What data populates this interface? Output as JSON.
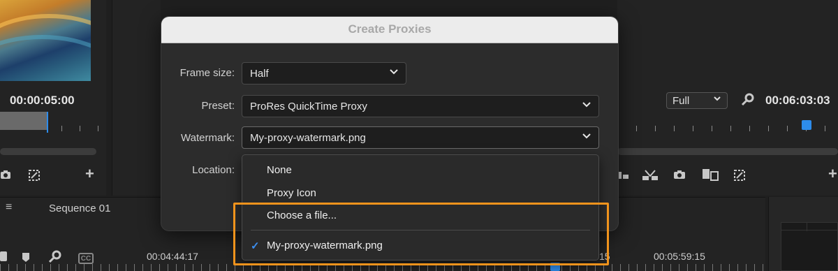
{
  "source_monitor": {
    "timecode": "00:00:05:00"
  },
  "program_monitor": {
    "zoom_label": "Full",
    "timecode": "00:06:03:03"
  },
  "timeline": {
    "menu_glyph": "≡",
    "sequence_tab": "Sequence 01",
    "time_left": "00:04:44:17",
    "time_right": "00:05:59:15",
    "time_partial": "15",
    "cc_label": "CC"
  },
  "dialog": {
    "title": "Create Proxies",
    "frame_size": {
      "label": "Frame size:",
      "value": "Half"
    },
    "preset": {
      "label": "Preset:",
      "value": "ProRes QuickTime Proxy"
    },
    "watermark": {
      "label": "Watermark:",
      "value": "My-proxy-watermark.png"
    },
    "location": {
      "label": "Location:"
    }
  },
  "watermark_menu": {
    "items": [
      {
        "label": "None",
        "checked": false
      },
      {
        "label": "Proxy Icon",
        "checked": false
      },
      {
        "label": "Choose a file...",
        "checked": false
      },
      {
        "label": "My-proxy-watermark.png",
        "checked": true
      }
    ],
    "check_glyph": "✓"
  },
  "colors": {
    "accent_blue": "#2d8ceb",
    "highlight_orange": "#f0931c"
  }
}
